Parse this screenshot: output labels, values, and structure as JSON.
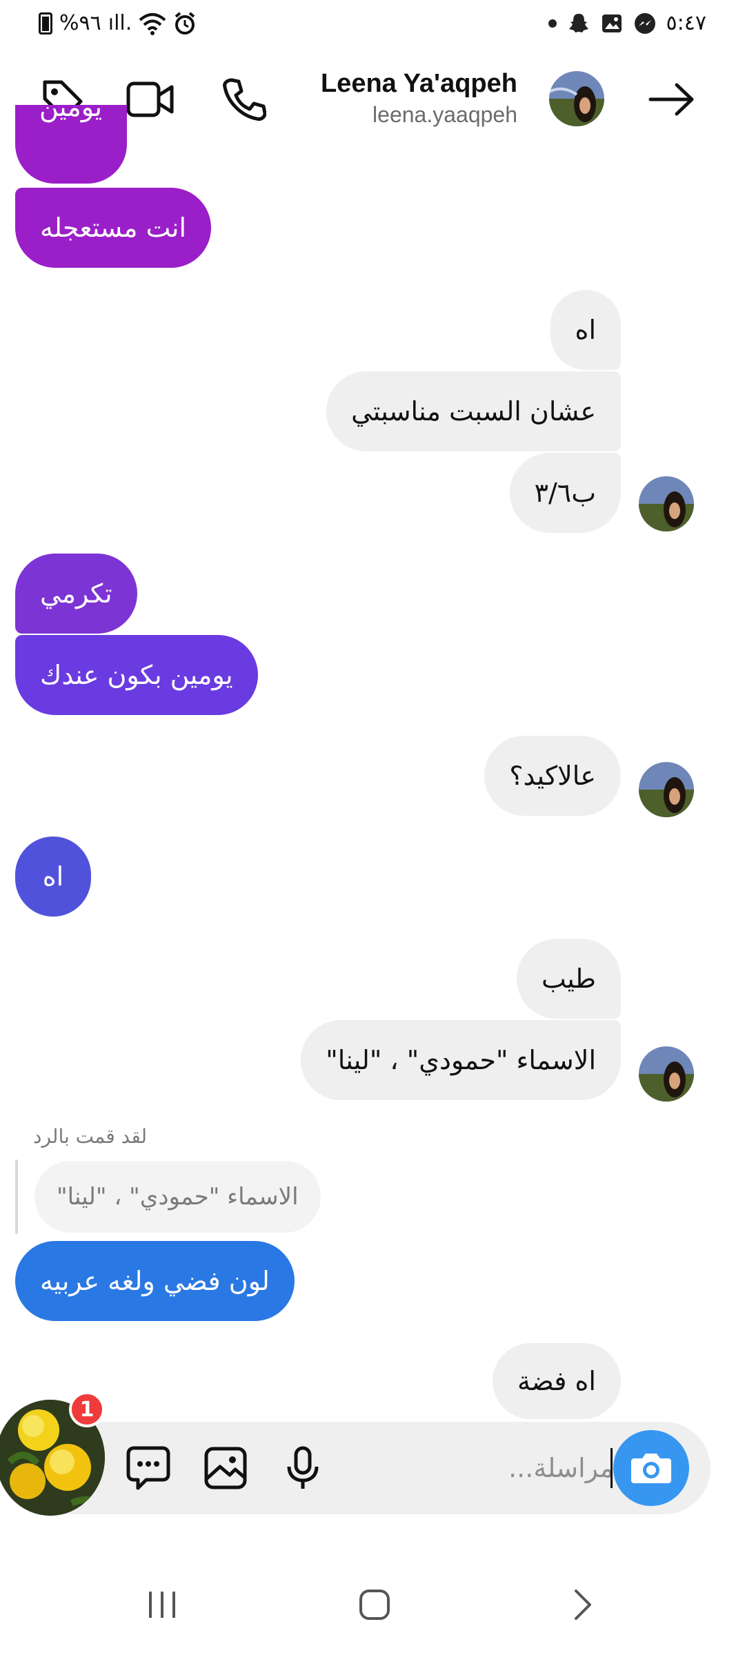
{
  "status_bar": {
    "battery": "%٩٦",
    "time": "٥:٤٧",
    "signal_glyph": "ıll.",
    "icons": [
      "battery-icon",
      "signal-icon",
      "wifi-icon",
      "alarm-icon",
      "dot-icon",
      "snapchat-icon",
      "gallery-icon",
      "messenger-icon"
    ]
  },
  "header": {
    "name": "Leena Ya'aqpeh",
    "handle": "leena.yaaqpeh",
    "icons": [
      "tag-icon",
      "video-call-icon",
      "phone-icon",
      "forward-arrow-icon"
    ]
  },
  "messages": [
    {
      "id": "m0",
      "side": "out",
      "text": "يومين",
      "color": "#9b1fc8"
    },
    {
      "id": "m1",
      "side": "out",
      "text": "انت مستعجله",
      "color": "#9b1fc8"
    },
    {
      "id": "m2",
      "side": "in",
      "text": "اه"
    },
    {
      "id": "m3",
      "side": "in",
      "text": "عشان السبت مناسبتي"
    },
    {
      "id": "m4",
      "side": "in",
      "text": "ب٣/٦"
    },
    {
      "id": "m5",
      "side": "out",
      "text": "تكرمي",
      "color": "#7d34d4"
    },
    {
      "id": "m6",
      "side": "out",
      "text": "يومين بكون عندك",
      "color": "#6a3be0"
    },
    {
      "id": "m7",
      "side": "in",
      "text": "عالاكيد؟"
    },
    {
      "id": "m8",
      "side": "out",
      "text": "اه",
      "color": "#5152db"
    },
    {
      "id": "m9",
      "side": "in",
      "text": "طيب"
    },
    {
      "id": "m10",
      "side": "in",
      "text": "الاسماء  \"حمودي\" ، \"لينا\""
    },
    {
      "id": "m11",
      "side": "out",
      "text": "لون فضي ولغه عربيه",
      "color": "#2a78e4"
    },
    {
      "id": "m12",
      "side": "in",
      "text": "اه فضة"
    }
  ],
  "reply": {
    "label": "لقد قمت بالرد",
    "quote": "الاسماء  \"حمودي\" ، \"لينا\""
  },
  "composer": {
    "placeholder": "مراسلة...",
    "icons": [
      "camera-icon",
      "microphone-icon",
      "image-icon",
      "sticker-chat-icon"
    ]
  },
  "chat_head": {
    "badge": "1"
  },
  "nav": {
    "icons": [
      "recent-apps-icon",
      "home-icon",
      "back-icon"
    ]
  }
}
